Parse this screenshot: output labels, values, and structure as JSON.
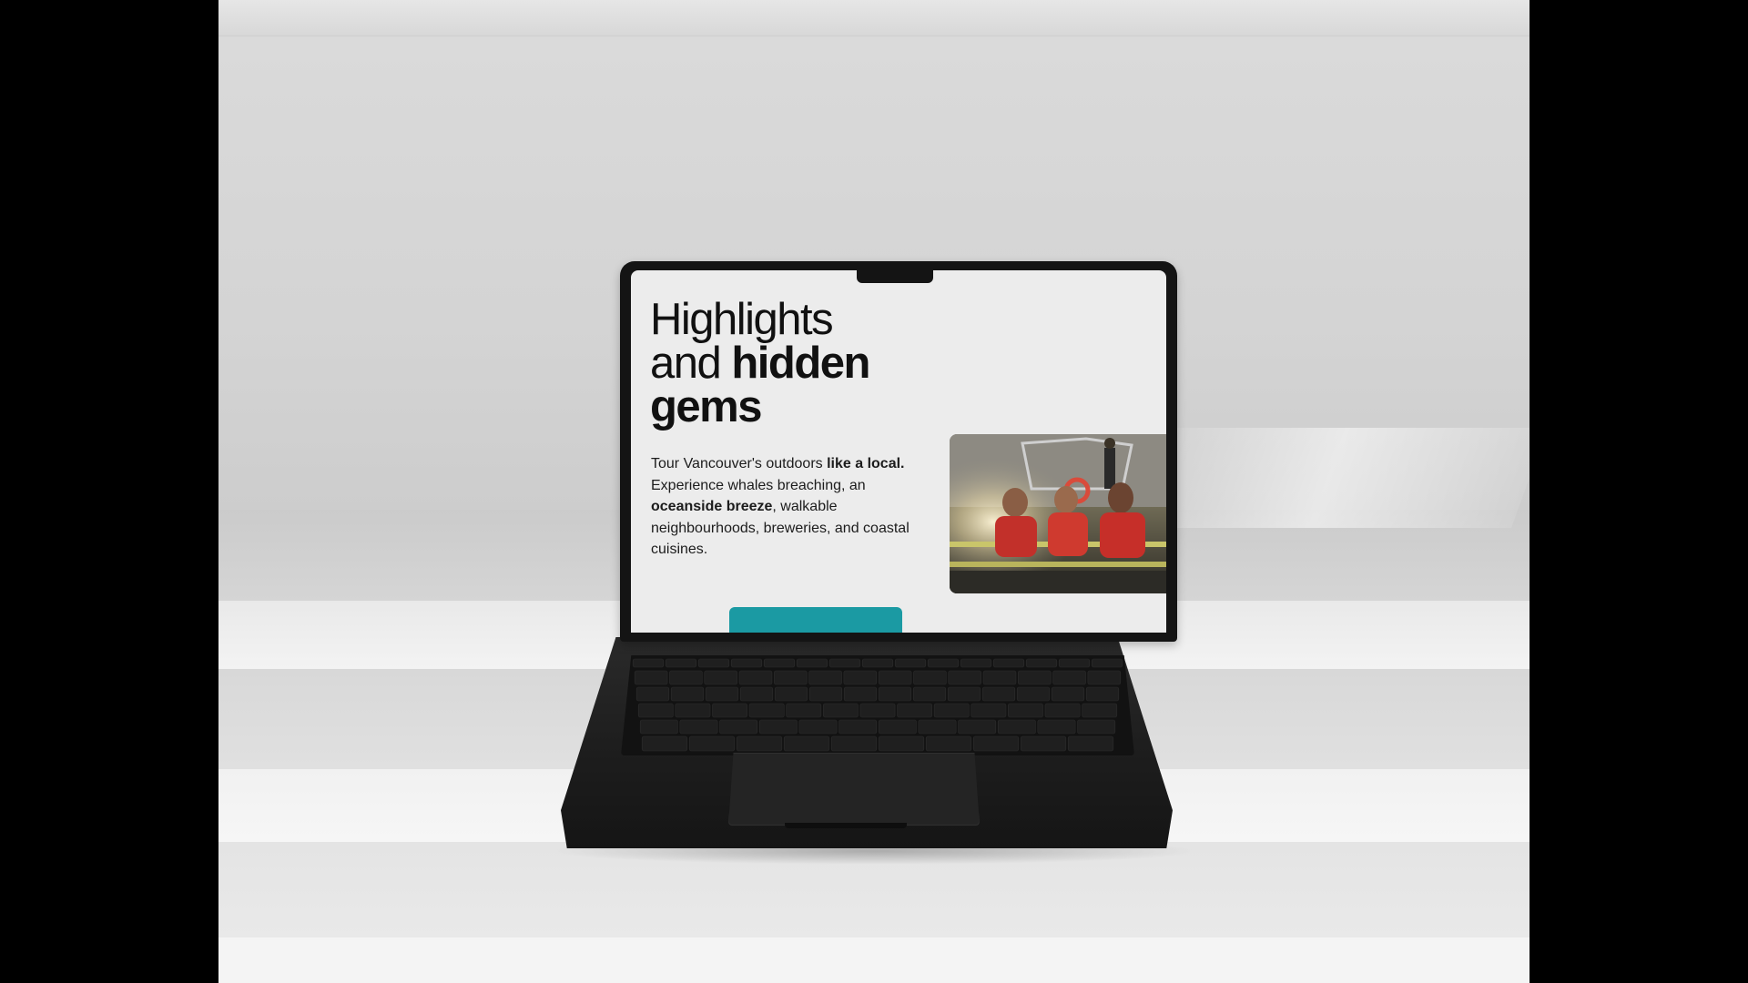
{
  "screen": {
    "headline": {
      "line1": "Highlights",
      "line2_regular": "and ",
      "line2_bold": "hidden",
      "line3_bold": "gems"
    },
    "body": {
      "part1": "Tour Vancouver's outdoors ",
      "part2_bold": "like a local.",
      "part3": " Experience whales breaching, an ",
      "part4_bold": "oceanside breeze",
      "part5": ", walkable neighbourhoods, breweries, and coastal cuisines."
    },
    "photo_icon": "boat-tour-photo",
    "cta_color": "#1b9aa3"
  },
  "laptop": {
    "color": "#141414"
  },
  "background": {
    "color": "#d9d9d9"
  }
}
